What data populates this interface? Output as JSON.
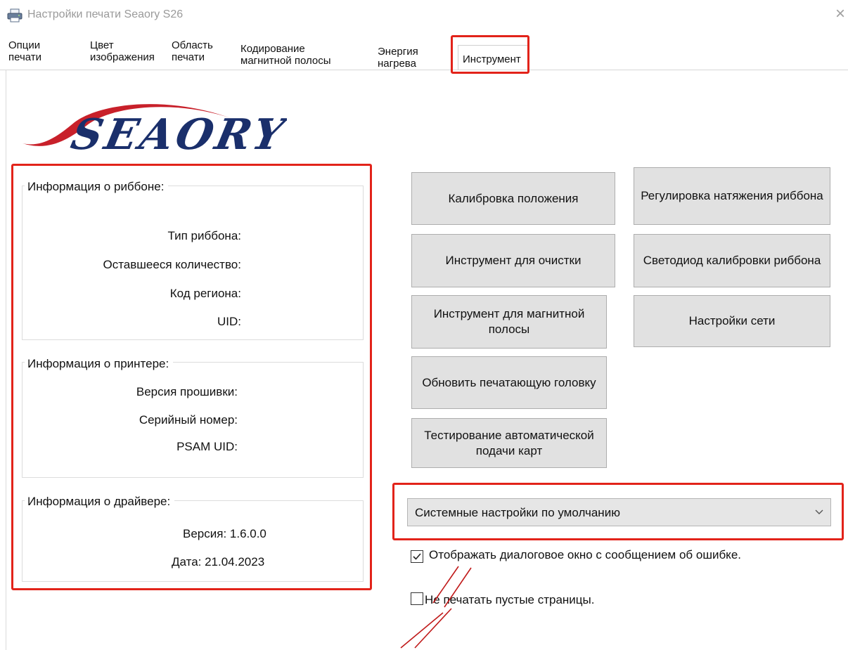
{
  "window": {
    "title": "Настройки печати Seaory S26",
    "close": "×"
  },
  "tabs": [
    {
      "label": "Опции печати"
    },
    {
      "label": "Цвет изображения"
    },
    {
      "label": "Область печати"
    },
    {
      "label": "Кодирование магнитной полосы"
    },
    {
      "label": "Энергия нагрева"
    },
    {
      "label": "Инструмент"
    }
  ],
  "active_tab": "Инструмент",
  "logo": {
    "text": "SEAORY",
    "colors": {
      "swoosh": "#c8202a",
      "letters": "#1a2f6b"
    }
  },
  "ribbon_info": {
    "title": "Информация о риббоне:",
    "type_label": "Тип риббона:",
    "remaining_label": "Оставшееся количество:",
    "region_label": "Код региона:",
    "uid_label": "UID:"
  },
  "printer_info": {
    "title": "Информация о принтере:",
    "firmware_label": "Версия прошивки:",
    "serial_label": "Серийный номер:",
    "psam_label": "PSAM UID:"
  },
  "driver_info": {
    "title": "Информация о драйвере:",
    "version": "Версия: 1.6.0.0",
    "date": "Дата: 21.04.2023"
  },
  "buttons": {
    "calibrate_position": "Калибровка положения",
    "ribbon_tension": "Регулировка натяжения риббона",
    "cleaning_tool": "Инструмент для очистки",
    "ribbon_led": "Светодиод калибровки риббона",
    "mag_stripe_tool": "Инструмент для магнитной полосы",
    "network_settings": "Настройки сети",
    "update_printhead": "Обновить печатающую головку",
    "auto_feed_test": "Тестирование автоматической подачи карт"
  },
  "settings_select": {
    "value": "Системные настройки по умолчанию"
  },
  "options": {
    "show_error_dialog": {
      "label": "Отображать диалоговое окно с сообщением об ошибке.",
      "checked": true
    },
    "skip_blank_pages": {
      "label": "Не печатать пустые страницы.",
      "checked": false
    }
  },
  "colors": {
    "highlight": "#e2231a",
    "button_bg": "#e1e1e1",
    "button_border": "#adadad"
  }
}
